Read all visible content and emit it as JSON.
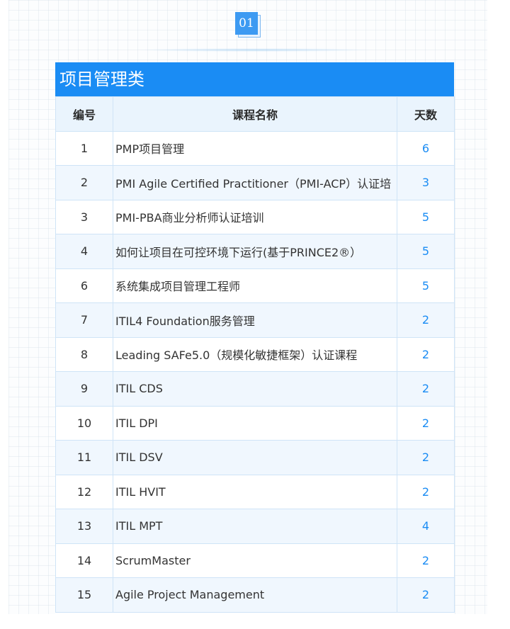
{
  "section": {
    "badge": "01",
    "title": "项目管理类"
  },
  "table": {
    "headers": [
      "编号",
      "课程名称",
      "天数"
    ],
    "rows": [
      [
        "1",
        "PMP项目管理",
        "6"
      ],
      [
        "2",
        "PMI Agile Certified Practitioner（PMI-ACP）认证培",
        "3"
      ],
      [
        "3",
        "PMI-PBA商业分析师认证培训",
        "5"
      ],
      [
        "4",
        "如何让项目在可控环境下运行(基于PRINCE2®）",
        "5"
      ],
      [
        "6",
        "系统集成项目管理工程师",
        "5"
      ],
      [
        "7",
        "ITIL4 Foundation服务管理",
        "2"
      ],
      [
        "8",
        "Leading SAFe5.0（规模化敏捷框架）认证课程",
        "2"
      ],
      [
        "9",
        "ITIL CDS",
        "2"
      ],
      [
        "10",
        "ITIL DPI",
        "2"
      ],
      [
        "11",
        "ITIL DSV",
        "2"
      ],
      [
        "12",
        "ITIL HVIT",
        "2"
      ],
      [
        "13",
        "ITIL MPT",
        "4"
      ],
      [
        "14",
        "ScrumMaster",
        "2"
      ],
      [
        "15",
        "Agile Project Management",
        "2"
      ]
    ]
  },
  "colors": {
    "accent": "#1a8cf4",
    "header_bg": "#eaf4fd",
    "stripe_bg": "#f0f7fe",
    "border": "#cfe4f7"
  }
}
